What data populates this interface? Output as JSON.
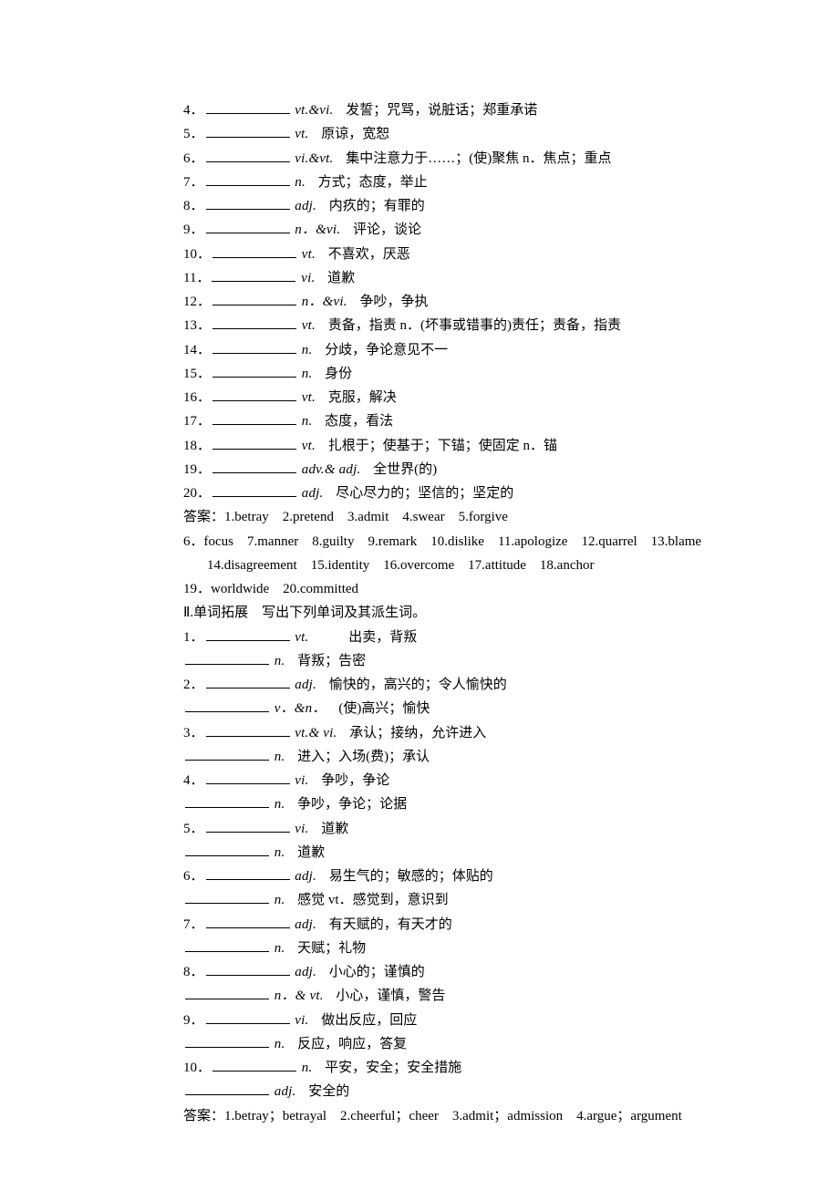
{
  "section1": {
    "items": [
      {
        "num": "4",
        "pos": "vt.&vi.",
        "def": "发誓；咒骂，说脏话；郑重承诺"
      },
      {
        "num": "5",
        "pos": "vt.",
        "def": "原谅，宽恕"
      },
      {
        "num": "6",
        "pos": "vi.&vt.",
        "def": "集中注意力于……；(使)聚焦 n．焦点；重点"
      },
      {
        "num": "7",
        "pos": "n.",
        "def": "方式；态度，举止"
      },
      {
        "num": "8",
        "pos": "adj.",
        "def": "内疚的；有罪的"
      },
      {
        "num": "9",
        "pos": "n．&vi.",
        "def": "评论，谈论"
      },
      {
        "num": "10",
        "pos": "vt.",
        "def": "不喜欢，厌恶"
      },
      {
        "num": "11",
        "pos": "vi.",
        "def": "道歉"
      },
      {
        "num": "12",
        "pos": "n．&vi.",
        "def": "争吵，争执"
      },
      {
        "num": "13",
        "pos": " vt.",
        "def": "责备，指责 n．(坏事或错事的)责任；责备，指责"
      },
      {
        "num": "14",
        "pos": "n.",
        "def": "分歧，争论意见不一"
      },
      {
        "num": "15",
        "pos": "n.",
        "def": "身份"
      },
      {
        "num": "16",
        "pos": "vt.",
        "def": "克服，解决"
      },
      {
        "num": "17",
        "pos": "n.",
        "def": "态度，看法"
      },
      {
        "num": "18",
        "pos": "vt.",
        "def": "扎根于；使基于；下锚；使固定 n．锚"
      },
      {
        "num": "19",
        "pos": "adv.& adj.",
        "def": "全世界(的)"
      },
      {
        "num": "20",
        "pos": "adj.",
        "def": "尽心尽力的；坚信的；坚定的"
      }
    ],
    "answer1": "答案：1.betray　2.pretend　3.admit　4.swear　5.forgive",
    "answer2": "6．focus　7.manner　8.guilty　9.remark　10.dislike　11.apologize　12.quarrel　13.blame　14.disagreement　15.identity　16.overcome　17.attitude　18.anchor",
    "answer3": "19．worldwide　20.committed"
  },
  "section2": {
    "heading": "Ⅱ.单词拓展　写出下列单词及其派生词。",
    "items": [
      {
        "num": "1",
        "lines": [
          {
            "pos": "vt.",
            "def": "出卖，背叛",
            "wide": true
          },
          {
            "pos": "n.",
            "def": "背叛；告密"
          }
        ]
      },
      {
        "num": "2",
        "lines": [
          {
            "pos": "adj.",
            "def": "愉快的，高兴的；令人愉快的"
          },
          {
            "pos": "v．&n．",
            "def": "(使)高兴；愉快"
          }
        ]
      },
      {
        "num": "3",
        "lines": [
          {
            "pos": "vt.& vi.",
            "def": "承认；接纳，允许进入"
          },
          {
            "pos": "n.",
            "def": "进入；入场(费)；承认"
          }
        ]
      },
      {
        "num": "4",
        "lines": [
          {
            "pos": "vi.",
            "def": "争吵，争论"
          },
          {
            "pos": "n.",
            "def": "争吵，争论；论据"
          }
        ]
      },
      {
        "num": "5",
        "lines": [
          {
            "pos": "vi.",
            "def": "道歉"
          },
          {
            "pos": "n.",
            "def": "道歉"
          }
        ]
      },
      {
        "num": "6",
        "lines": [
          {
            "pos": "adj.",
            "def": "易生气的；敏感的；体贴的"
          },
          {
            "pos": "n.",
            "def": "感觉 vt．感觉到，意识到"
          }
        ]
      },
      {
        "num": "7",
        "lines": [
          {
            "pos": "adj.",
            "def": "有天赋的，有天才的"
          },
          {
            "pos": "n.",
            "def": "天赋；礼物"
          }
        ]
      },
      {
        "num": "8",
        "lines": [
          {
            "pos": "adj.",
            "def": "小心的；谨慎的"
          },
          {
            "pos": "n．& vt.",
            "def": "小心，谨慎，警告"
          }
        ]
      },
      {
        "num": "9",
        "lines": [
          {
            "pos": "vi.",
            "def": "做出反应，回应"
          },
          {
            "pos": "n.",
            "def": "反应，响应，答复"
          }
        ]
      },
      {
        "num": "10",
        "lines": [
          {
            "pos": "n.",
            "def": "平安，安全；安全措施"
          },
          {
            "pos": "adj.",
            "def": "安全的"
          }
        ]
      }
    ],
    "answer": "答案：1.betray；betrayal　2.cheerful；cheer　3.admit；admission　4.argue；argument"
  }
}
